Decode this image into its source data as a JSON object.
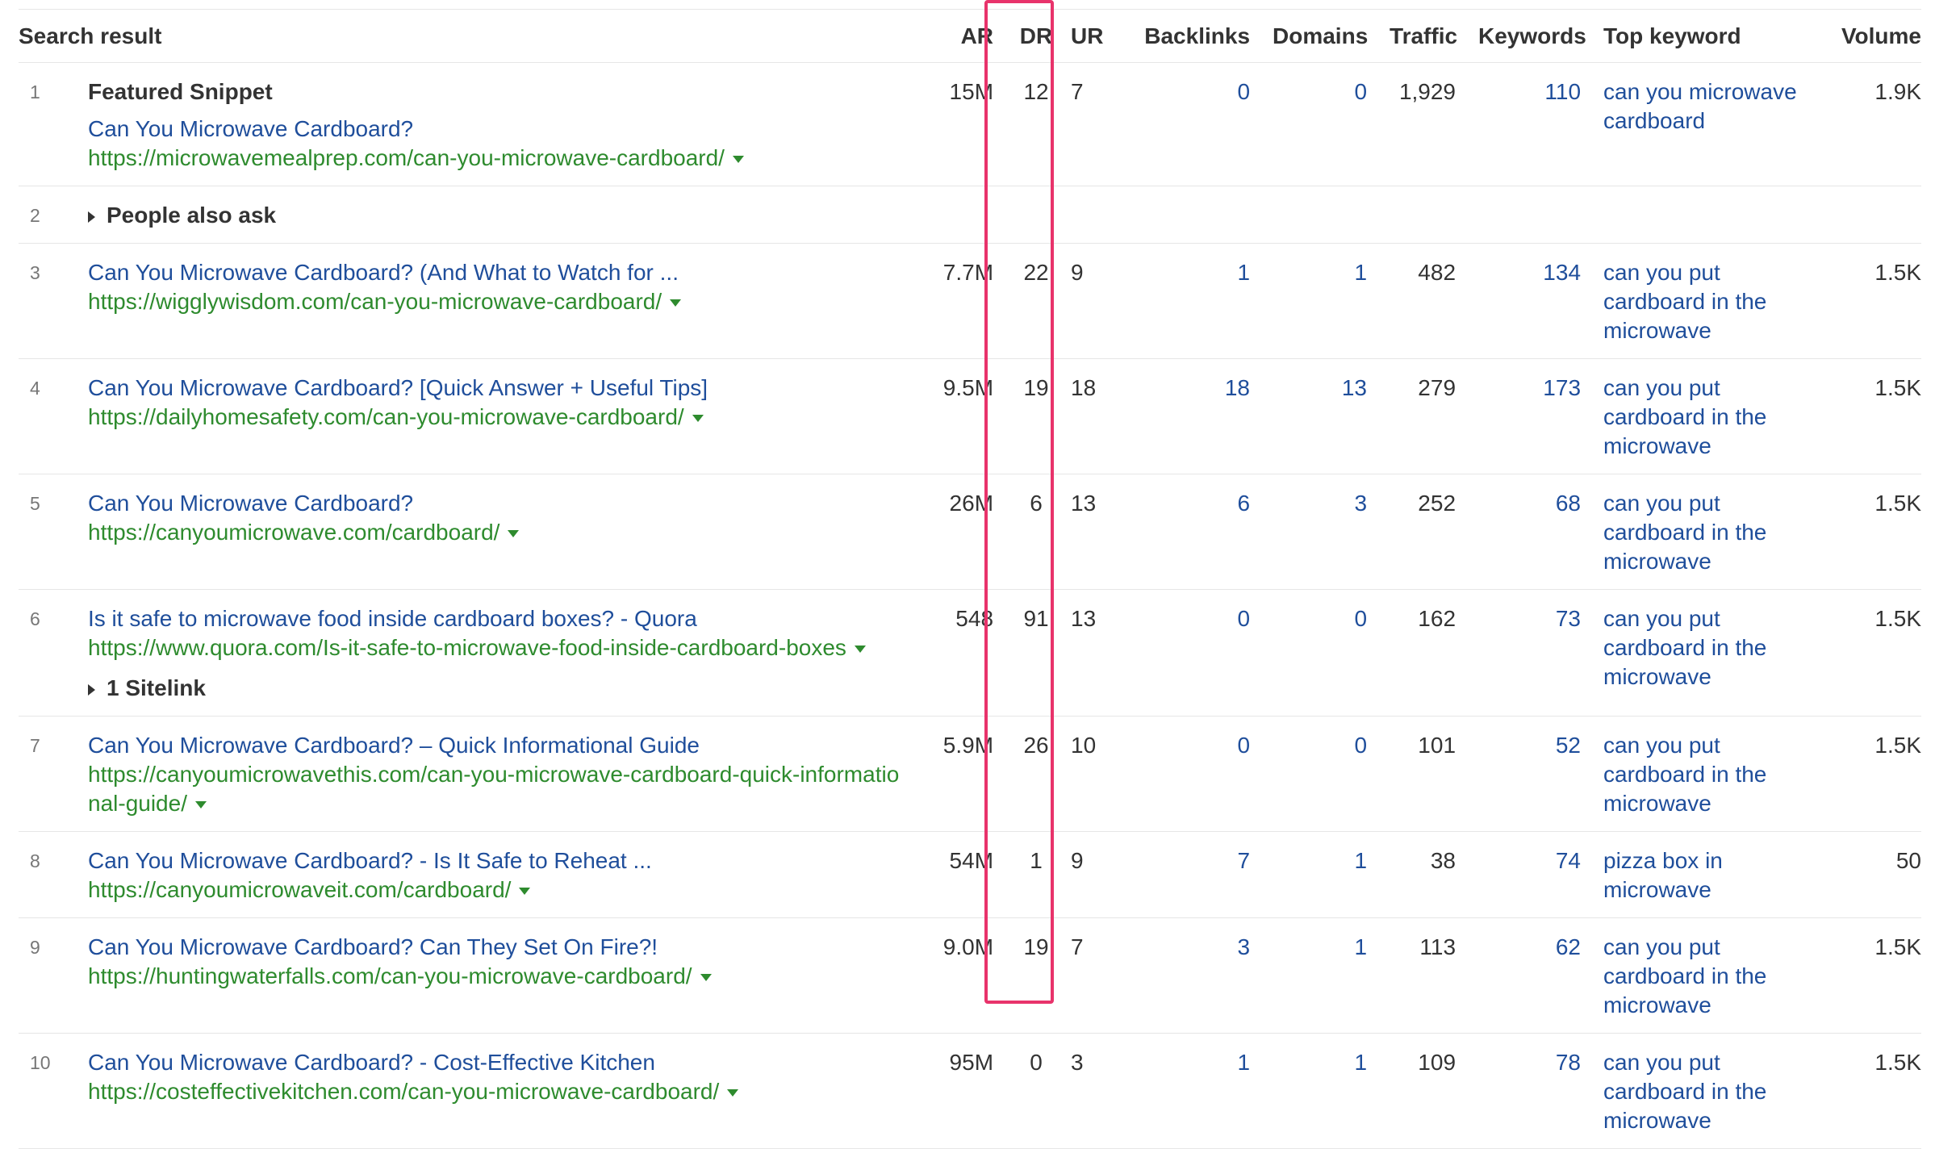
{
  "columns": {
    "result": "Search result",
    "ar": "AR",
    "dr": "DR",
    "ur": "UR",
    "backlinks": "Backlinks",
    "domains": "Domains",
    "traffic": "Traffic",
    "keywords": "Keywords",
    "top_keyword": "Top keyword",
    "volume": "Volume"
  },
  "colors": {
    "link": "#1f4e9b",
    "url": "#2e8b2e",
    "highlight": "#e8336b"
  },
  "rows": [
    {
      "pos": "1",
      "label": "Featured Snippet",
      "title": "Can You Microwave Cardboard?",
      "url": "https://microwavemealprep.com/can-you-microwave-cardboard/",
      "ar": "15M",
      "dr": "12",
      "ur": "7",
      "backlinks": "0",
      "domains": "0",
      "traffic": "1,929",
      "keywords": "110",
      "top_keyword": "can you microwave cardboard",
      "volume": "1.9K"
    },
    {
      "pos": "2",
      "expander": "People also ask"
    },
    {
      "pos": "3",
      "title": "Can You Microwave Cardboard? (And What to Watch for ...",
      "url": "https://wigglywisdom.com/can-you-microwave-cardboard/",
      "ar": "7.7M",
      "dr": "22",
      "ur": "9",
      "backlinks": "1",
      "domains": "1",
      "traffic": "482",
      "keywords": "134",
      "top_keyword": "can you put cardboard in the microwave",
      "volume": "1.5K"
    },
    {
      "pos": "4",
      "title": "Can You Microwave Cardboard? [Quick Answer + Useful Tips]",
      "url": "https://dailyhomesafety.com/can-you-microwave-cardboard/",
      "ar": "9.5M",
      "dr": "19",
      "ur": "18",
      "backlinks": "18",
      "domains": "13",
      "traffic": "279",
      "keywords": "173",
      "top_keyword": "can you put cardboard in the microwave",
      "volume": "1.5K"
    },
    {
      "pos": "5",
      "title": "Can You Microwave Cardboard?",
      "url": "https://canyoumicrowave.com/cardboard/",
      "ar": "26M",
      "dr": "6",
      "ur": "13",
      "backlinks": "6",
      "domains": "3",
      "traffic": "252",
      "keywords": "68",
      "top_keyword": "can you put cardboard in the microwave",
      "volume": "1.5K"
    },
    {
      "pos": "6",
      "title": "Is it safe to microwave food inside cardboard boxes? - Quora",
      "url": "https://www.quora.com/Is-it-safe-to-microwave-food-inside-cardboard-boxes",
      "sitelink": "1 Sitelink",
      "ar": "548",
      "dr": "91",
      "ur": "13",
      "backlinks": "0",
      "domains": "0",
      "traffic": "162",
      "keywords": "73",
      "top_keyword": "can you put cardboard in the microwave",
      "volume": "1.5K"
    },
    {
      "pos": "7",
      "title": "Can You Microwave Cardboard? – Quick Informational Guide",
      "url": "https://canyoumicrowavethis.com/can-you-microwave-cardboard-quick-informational-guide/",
      "ar": "5.9M",
      "dr": "26",
      "ur": "10",
      "backlinks": "0",
      "domains": "0",
      "traffic": "101",
      "keywords": "52",
      "top_keyword": "can you put cardboard in the microwave",
      "volume": "1.5K"
    },
    {
      "pos": "8",
      "title": "Can You Microwave Cardboard? - Is It Safe to Reheat ...",
      "url": "https://canyoumicrowaveit.com/cardboard/",
      "ar": "54M",
      "dr": "1",
      "ur": "9",
      "backlinks": "7",
      "domains": "1",
      "traffic": "38",
      "keywords": "74",
      "top_keyword": "pizza box in microwave",
      "volume": "50"
    },
    {
      "pos": "9",
      "title": "Can You Microwave Cardboard? Can They Set On Fire?!",
      "url": "https://huntingwaterfalls.com/can-you-microwave-cardboard/",
      "ar": "9.0M",
      "dr": "19",
      "ur": "7",
      "backlinks": "3",
      "domains": "1",
      "traffic": "113",
      "keywords": "62",
      "top_keyword": "can you put cardboard in the microwave",
      "volume": "1.5K"
    },
    {
      "pos": "10",
      "title": "Can You Microwave Cardboard? - Cost-Effective Kitchen",
      "url": "https://costeffectivekitchen.com/can-you-microwave-cardboard/",
      "ar": "95M",
      "dr": "0",
      "ur": "3",
      "backlinks": "1",
      "domains": "1",
      "traffic": "109",
      "keywords": "78",
      "top_keyword": "can you put cardboard in the microwave",
      "volume": "1.5K"
    }
  ]
}
